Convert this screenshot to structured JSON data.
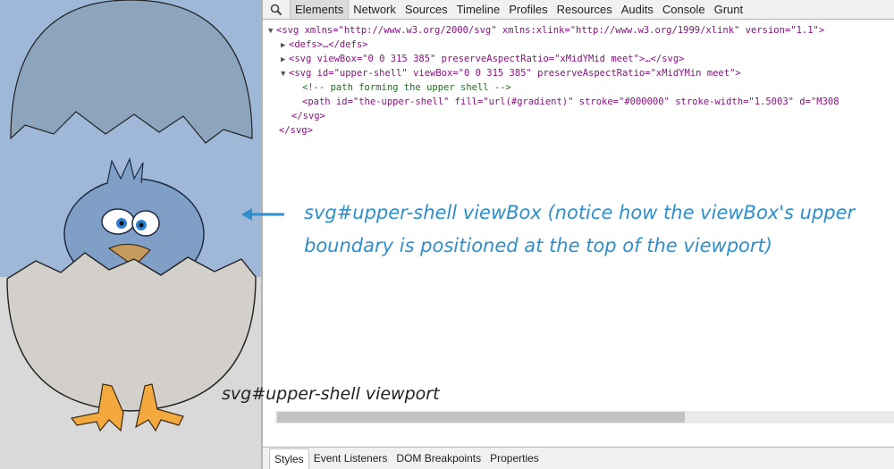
{
  "devtools": {
    "tabs": [
      "Elements",
      "Network",
      "Sources",
      "Timeline",
      "Profiles",
      "Resources",
      "Audits",
      "Console",
      "Grunt"
    ],
    "active_tab": "Elements",
    "bottom_tabs": [
      "Styles",
      "Event Listeners",
      "DOM Breakpoints",
      "Properties"
    ],
    "active_bottom_tab": "Styles"
  },
  "dom_lines": [
    "<svg xmlns=\"http://www.w3.org/2000/svg\" xmlns:xlink=\"http://www.w3.org/1999/xlink\" version=\"1.1\">",
    "<defs>…</defs>",
    "<svg viewBox=\"0 0 315 385\" preserveAspectRatio=\"xMidYMid meet\">…</svg>",
    "<svg id=\"upper-shell\" viewBox=\"0 0 315 385\" preserveAspectRatio=\"xMidYMin meet\">",
    "<!-- path forming the upper shell -->",
    "<path id=\"the-upper-shell\" fill=\"url(#gradient)\" stroke=\"#000000\" stroke-width=\"1.5003\" d=\"M308",
    "</svg>",
    "</svg>"
  ],
  "annotation": {
    "line1": "svg#upper-shell viewBox (notice how the viewBox's upper",
    "line2": "boundary is positioned at the top of the viewport)",
    "viewport_label": "svg#upper-shell viewport",
    "color": "#2e8fcc"
  },
  "colors": {
    "viewbox_highlight": "#9fb8d8",
    "egg_fill": "#d3d0cb"
  }
}
